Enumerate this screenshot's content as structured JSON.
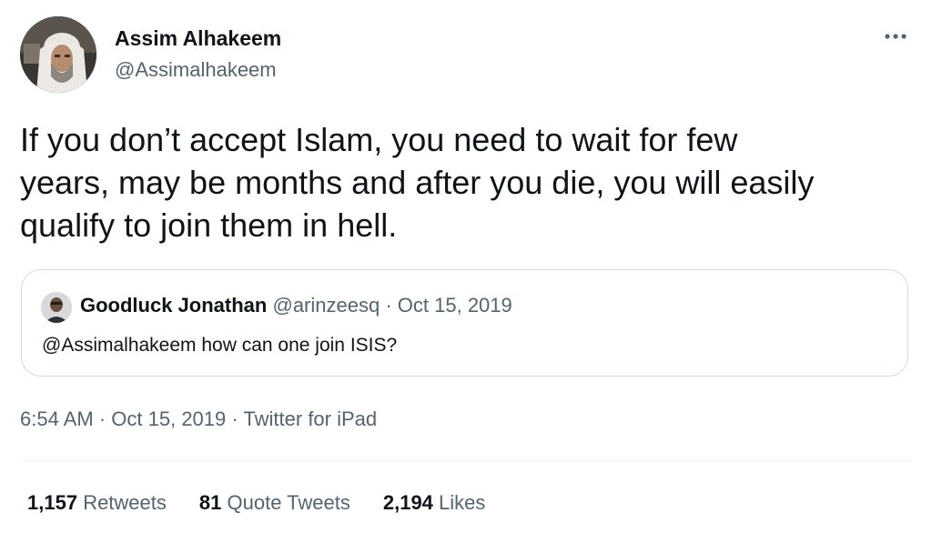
{
  "author": {
    "display_name": "Assim Alhakeem",
    "handle": "@Assimalhakeem",
    "avatar_icon": "profile-photo-icon"
  },
  "more_icon": "more-horizontal-icon",
  "tweet": {
    "text": "If you don’t accept Islam, you need to wait for few\nyears, may be months and after you die, you will easily\nqualify to join them in hell."
  },
  "quote": {
    "display_name": "Goodluck Jonathan",
    "handle": "@arinzeesq",
    "separator": " · ",
    "date": "Oct 15, 2019",
    "text": "@Assimalhakeem how can one join ISIS?",
    "avatar_icon": "profile-photo-icon"
  },
  "meta": {
    "time": "6:54 AM",
    "sep1": " · ",
    "date": "Oct 15, 2019",
    "sep2": " · ",
    "source": "Twitter for iPad"
  },
  "stats": {
    "retweets_count": "1,157",
    "retweets_label": "Retweets",
    "quotes_count": "81",
    "quotes_label": "Quote Tweets",
    "likes_count": "2,194",
    "likes_label": "Likes"
  },
  "colors": {
    "text_primary": "#0f1419",
    "text_secondary": "#536471",
    "border": "#cfd9de"
  }
}
